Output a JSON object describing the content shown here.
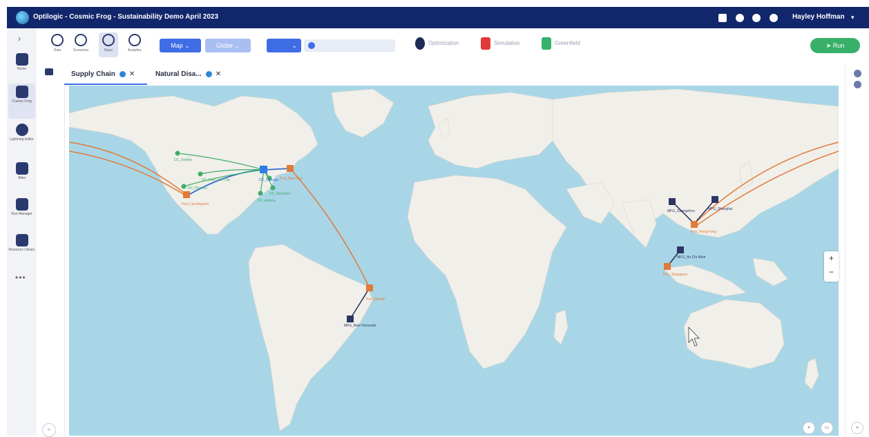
{
  "header": {
    "title": "Optilogic - Cosmic Frog - Sustainability Demo April 2023",
    "user": "Hayley Hoffman"
  },
  "nav": [
    {
      "label": "Home"
    },
    {
      "label": "Cosmic Frog"
    },
    {
      "label": "Lightning Editor"
    },
    {
      "label": "Atlas"
    },
    {
      "label": "Run Manager"
    },
    {
      "label": "Resource Library"
    }
  ],
  "nav_more": "•••",
  "toolbar": {
    "buttons": [
      {
        "label": "Data"
      },
      {
        "label": "Scenarios"
      },
      {
        "label": "Maps"
      },
      {
        "label": "Analytics"
      }
    ],
    "map_dropdown": "Map ⌄",
    "globe_dropdown": "Globe ⌄",
    "select_dropdown": "⌄",
    "modes": [
      {
        "label": "Optimization",
        "color": "#1f2a55"
      },
      {
        "label": "Simulation",
        "color": "#e03a3a"
      },
      {
        "label": "Greenfield",
        "color": "#34b36a"
      }
    ],
    "run_label": "➤ Run"
  },
  "tabs": [
    {
      "label": "Supply Chain"
    },
    {
      "label": "Natural Disa..."
    }
  ],
  "map": {
    "water_color": "#a9d6e6",
    "land_color": "#f1efe9",
    "labels": {
      "dc_seattle": "DC_Seattle",
      "dc_salt_lake": "DC_Salt Lake City",
      "dc_phoenix": "DC_Phoenix",
      "port_la": "Port_Los Angeles",
      "dc_chicago": "DC_Chicago",
      "port_ny": "Port_New York",
      "dc_nashville": "DC_Nashville",
      "dc_atlanta": "DC_Atlanta",
      "mfg_shanghai": "MFG_Shanghai",
      "mfg_guangzhou": "MFG_Guangzhou",
      "port_hong_kong": "Port_Hong Kong",
      "mfg_hcm": "MFG_Ho Chi Minh",
      "port_singapore": "Port_Singapore",
      "port_brazil": "Port_Rio/SP",
      "mfg_belo": "MFG_Belo Horizonte"
    }
  }
}
